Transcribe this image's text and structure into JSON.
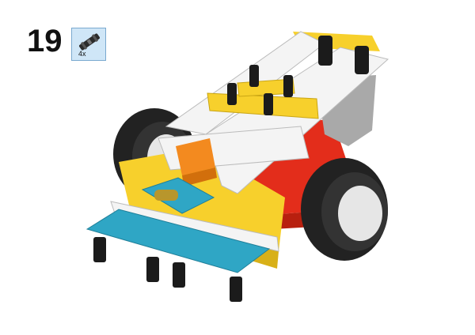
{
  "step": {
    "number": "19"
  },
  "parts_list": [
    {
      "quantity": "4x",
      "icon": "connector-peg-icon"
    }
  ],
  "colors": {
    "yellow": "#f7d02c",
    "white": "#f4f4f4",
    "red": "#e32d1b",
    "azure": "#2fa6c5",
    "black": "#1b1b1b",
    "orange": "#f38a1f",
    "gray": "#a9a9a9",
    "callout_bg": "#cfe6f7"
  }
}
